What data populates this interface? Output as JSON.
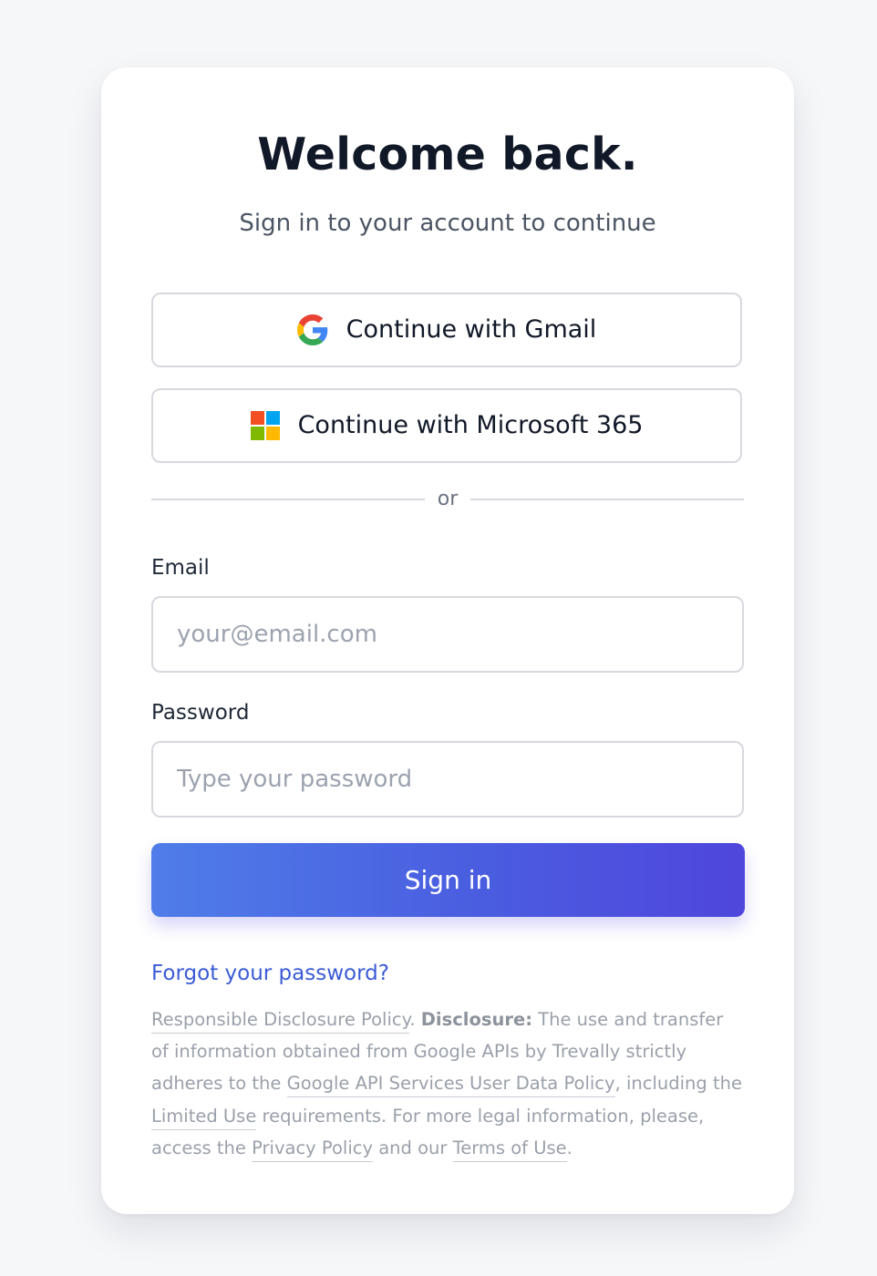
{
  "login": {
    "title": "Welcome back.",
    "subtitle": "Sign in to your account to continue",
    "oauth": {
      "gmail_label": "Continue with Gmail",
      "microsoft_label": "Continue with Microsoft 365"
    },
    "divider_text": "or",
    "email": {
      "label": "Email",
      "placeholder": "your@email.com",
      "value": ""
    },
    "password": {
      "label": "Password",
      "placeholder": "Type your password",
      "value": ""
    },
    "signin_label": "Sign in",
    "forgot_label": "Forgot your password?"
  },
  "legal": {
    "disclosure_policy_link": "Responsible Disclosure Policy",
    "sep1": ". ",
    "disclosure_bold": "Disclosure:",
    "text1": " The use and transfer of information obtained from Google APIs by Trevally strictly adheres to the ",
    "google_policy_link": "Google API Services User Data Policy",
    "text2": ", including the ",
    "limited_use_link": "Limited Use",
    "text3": " requirements. For more legal information, please, access the ",
    "privacy_link": "Privacy Policy",
    "text4": " and our ",
    "terms_link": "Terms of Use",
    "text5": "."
  },
  "icons": {
    "google": "google-g-icon",
    "microsoft": "microsoft-logo-icon"
  },
  "colors": {
    "accent_start": "#4f7de9",
    "accent_end": "#4f46dc",
    "link": "#3b5bd6",
    "ms_red": "#f25022",
    "ms_blue": "#00a4ef",
    "ms_green": "#7fba00",
    "ms_yellow": "#ffb900"
  }
}
